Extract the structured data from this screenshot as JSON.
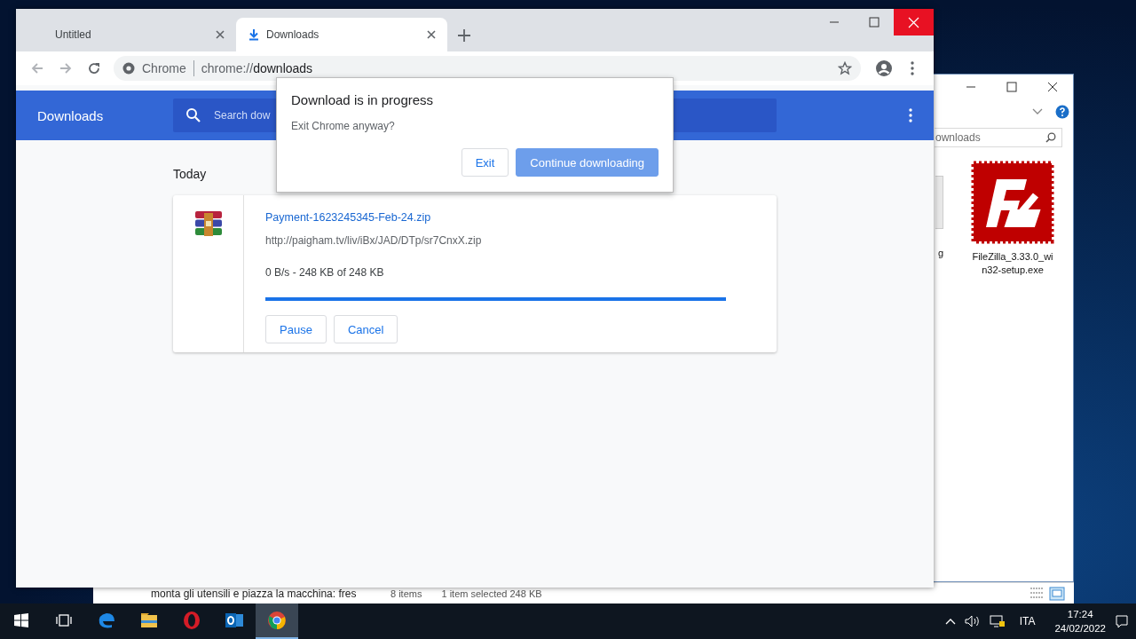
{
  "browser": {
    "tabs": [
      {
        "title": "Untitled",
        "kind": "blank",
        "selected": false
      },
      {
        "title": "Downloads",
        "kind": "download",
        "selected": true
      }
    ],
    "omnibox": {
      "chip": "Chrome",
      "url_scheme": "chrome://",
      "url_path": "downloads"
    }
  },
  "page": {
    "title": "Downloads",
    "search_placeholder": "Search dow",
    "section": "Today",
    "download": {
      "file": "Payment-1623245345-Feb-24.zip",
      "url": "http://paigham.tv/liv/iBx/JAD/DTp/sr7CnxX.zip",
      "status": "0 B/s - 248 KB of 248 KB",
      "level": 1,
      "buttons": [
        "Pause",
        "Cancel"
      ]
    }
  },
  "dialog": {
    "title": "Download is in progress",
    "message": "Exit Chrome anyway?",
    "buttons": [
      {
        "label": "Exit",
        "kind": "secondary"
      },
      {
        "label": "Continue downloading",
        "kind": "primary"
      }
    ]
  },
  "explorer": {
    "search_value": "ownloads",
    "files": [
      {
        "name": "g",
        "kind": "partial"
      },
      {
        "name": "FileZilla_3.33.0_win32-setup.exe",
        "kind": "filezilla"
      }
    ],
    "status": [
      "8 items",
      "1 item selected  248 KB"
    ]
  },
  "background_document": {
    "text": "monta gli utensili e piazza la macchina: fres"
  },
  "taskbar": {
    "apps": [
      {
        "kind": "edge",
        "selected": false
      },
      {
        "kind": "folder",
        "selected": false
      },
      {
        "kind": "opera",
        "selected": false
      },
      {
        "kind": "outlook",
        "selected": false
      },
      {
        "kind": "chrome",
        "selected": true
      }
    ],
    "language": "ITA",
    "time": "17:24",
    "date": "24/02/2022"
  }
}
